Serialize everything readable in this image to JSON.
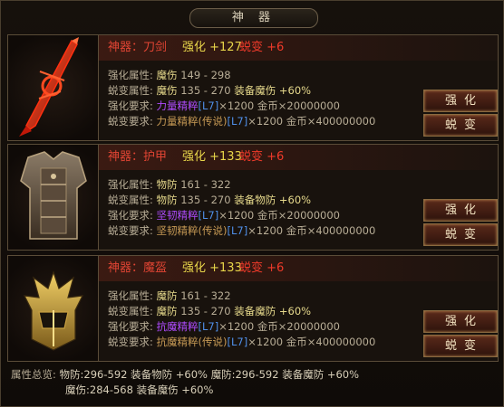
{
  "window": {
    "title": "神 器"
  },
  "buttons": {
    "enhance": "强化",
    "mutate": "蜕变"
  },
  "labels": {
    "enh_attr": "强化属性:",
    "mut_attr": "蜕变属性:",
    "enh_req": "强化要求:",
    "mut_req": "蜕变要求:",
    "times": "×1200",
    "gold": "金币",
    "dash": " - "
  },
  "items": [
    {
      "name": "神器：刀剑",
      "enhance": "强化 +127",
      "mutate": "蜕变 +6",
      "enh_attr_type": "魔伤",
      "enh_attr_range": "149 - 298",
      "mut_attr_type": "魔伤",
      "mut_attr_range": "135 - 270",
      "mut_bonus": "装备魔伤 +60%",
      "enh_req_item": "力量精粹",
      "enh_req_tag": "[L7]",
      "enh_req_qty": "×1200",
      "enh_req_gold": "×20000000",
      "mut_req_item": "力量精粹(传说)",
      "mut_req_tag": "[L7]",
      "mut_req_qty": "×1200",
      "mut_req_gold": "×400000000",
      "icon": "sword-icon"
    },
    {
      "name": "神器：护甲",
      "enhance": "强化 +133",
      "mutate": "蜕变 +6",
      "enh_attr_type": "物防",
      "enh_attr_range": "161 - 322",
      "mut_attr_type": "物防",
      "mut_attr_range": "135 - 270",
      "mut_bonus": "装备物防 +60%",
      "enh_req_item": "坚韧精粹",
      "enh_req_tag": "[L7]",
      "enh_req_qty": "×1200",
      "enh_req_gold": "×20000000",
      "mut_req_item": "坚韧精粹(传说)",
      "mut_req_tag": "[L7]",
      "mut_req_qty": "×1200",
      "mut_req_gold": "×400000000",
      "icon": "armor-icon"
    },
    {
      "name": "神器：魔盔",
      "enhance": "强化 +133",
      "mutate": "蜕变 +6",
      "enh_attr_type": "魔防",
      "enh_attr_range": "161 - 322",
      "mut_attr_type": "魔防",
      "mut_attr_range": "135 - 270",
      "mut_bonus": "装备魔防 +60%",
      "enh_req_item": "抗魔精粹",
      "enh_req_tag": "[L7]",
      "enh_req_qty": "×1200",
      "enh_req_gold": "×20000000",
      "mut_req_item": "抗魔精粹(传说)",
      "mut_req_tag": "[L7]",
      "mut_req_qty": "×1200",
      "mut_req_gold": "×400000000",
      "icon": "helmet-icon"
    }
  ],
  "summary": {
    "label": "属性总览:",
    "row1": "物防:296-592  装备物防 +60%  魔防:296-592  装备魔防 +60%",
    "row2": "魔伤:284-568  装备魔伤 +60%"
  },
  "colors": {
    "name": "#e04433",
    "enhance": "#e8d64a",
    "mutate": "#f03a2a",
    "purple_item": "#b04cff",
    "brown_item": "#c79a55",
    "tag": "#4f8fe8"
  }
}
